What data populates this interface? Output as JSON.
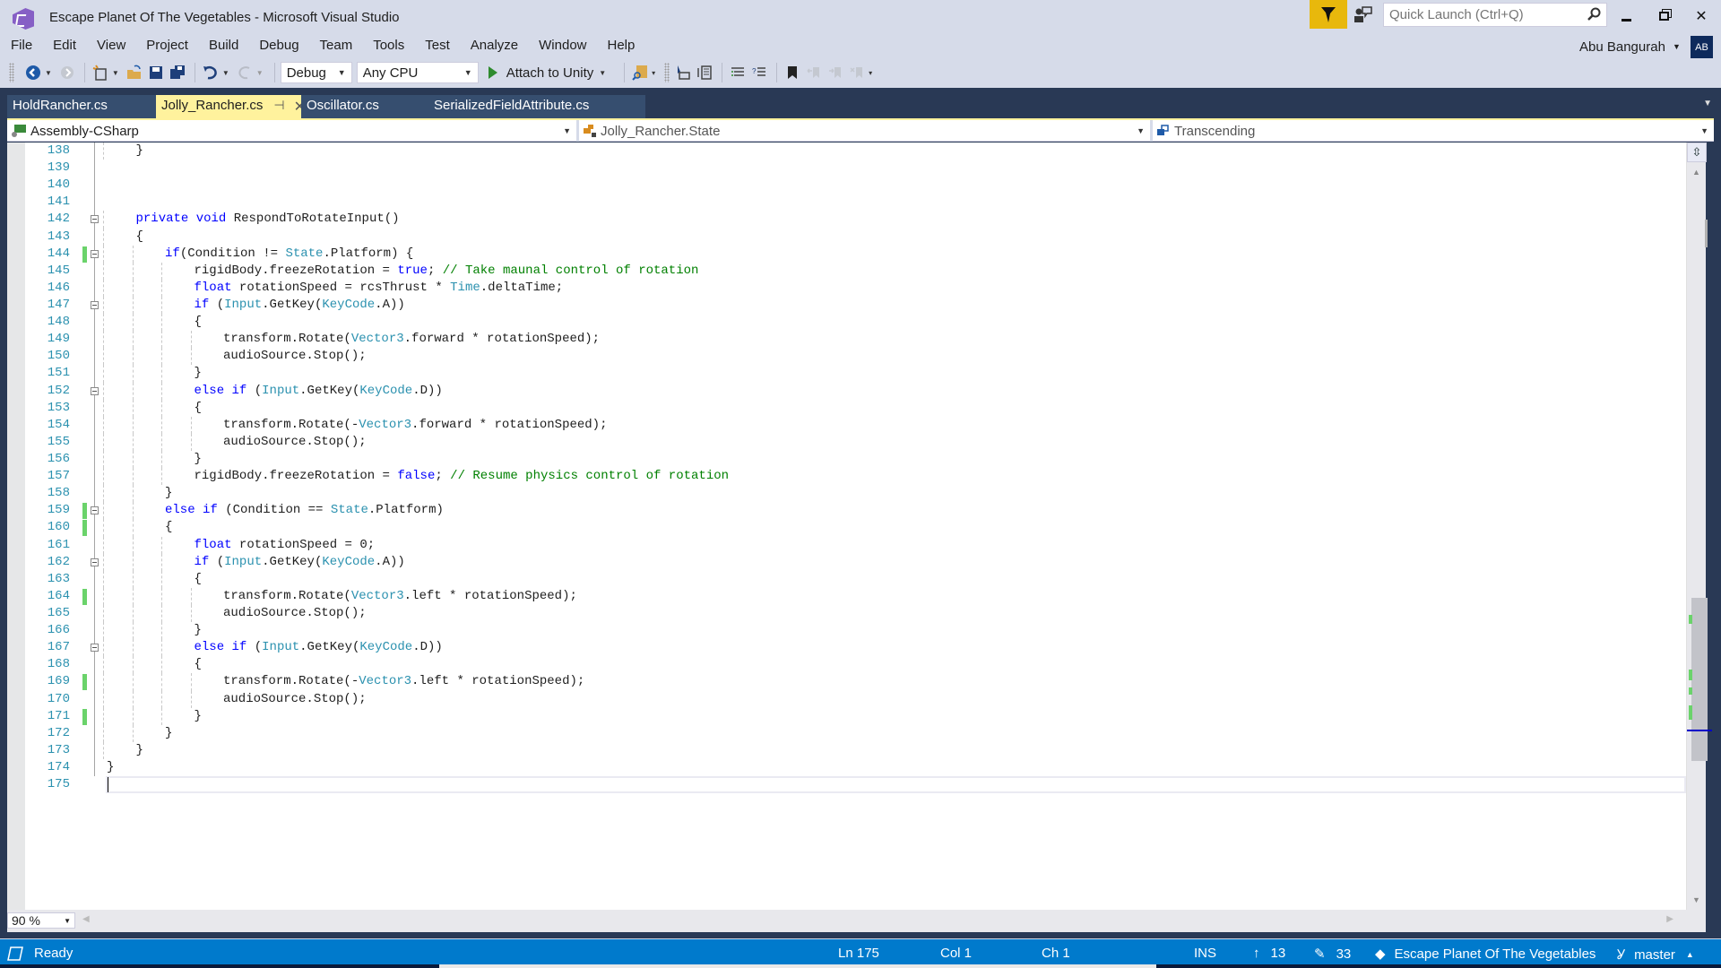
{
  "window": {
    "title": "Escape Planet Of The Vegetables - Microsoft Visual Studio",
    "quick_launch_placeholder": "Quick Launch (Ctrl+Q)",
    "user_name": "Abu Bangurah",
    "user_initials": "AB",
    "accent_color": "#e8b80c"
  },
  "menu": [
    "File",
    "Edit",
    "View",
    "Project",
    "Build",
    "Debug",
    "Team",
    "Tools",
    "Test",
    "Analyze",
    "Window",
    "Help"
  ],
  "toolbar": {
    "configuration": "Debug",
    "platform": "Any CPU",
    "attach_label": "Attach to Unity"
  },
  "tabs": [
    {
      "label": "HoldRancher.cs",
      "active": false
    },
    {
      "label": "Jolly_Rancher.cs",
      "active": true
    },
    {
      "label": "Oscillator.cs",
      "active": false
    },
    {
      "label": "SerializedFieldAttribute.cs",
      "active": false
    }
  ],
  "navbar": {
    "project": "Assembly-CSharp",
    "type": "Jolly_Rancher.State",
    "member": "Transcending"
  },
  "editor": {
    "zoom": "90 %",
    "current_line": 175,
    "lines": [
      {
        "n": 138,
        "indent": 1,
        "code": [
          [
            "p",
            "}"
          ]
        ]
      },
      {
        "n": 139,
        "indent": 0,
        "code": []
      },
      {
        "n": 140,
        "indent": 0,
        "code": []
      },
      {
        "n": 141,
        "indent": 0,
        "code": []
      },
      {
        "n": 142,
        "indent": 1,
        "fold": true,
        "code": [
          [
            "k",
            "private"
          ],
          [
            "p",
            " "
          ],
          [
            "k",
            "void"
          ],
          [
            "p",
            " RespondToRotateInput()"
          ]
        ]
      },
      {
        "n": 143,
        "indent": 1,
        "code": [
          [
            "p",
            "{"
          ]
        ]
      },
      {
        "n": 144,
        "indent": 2,
        "fold": true,
        "changed": true,
        "code": [
          [
            "k",
            "if"
          ],
          [
            "p",
            "(Condition != "
          ],
          [
            "t",
            "State"
          ],
          [
            "p",
            ".Platform) {"
          ]
        ]
      },
      {
        "n": 145,
        "indent": 3,
        "code": [
          [
            "p",
            "rigidBody.freezeRotation = "
          ],
          [
            "k",
            "true"
          ],
          [
            "p",
            "; "
          ],
          [
            "c",
            "// Take maunal control of rotation"
          ]
        ]
      },
      {
        "n": 146,
        "indent": 3,
        "code": [
          [
            "k",
            "float"
          ],
          [
            "p",
            " rotationSpeed = rcsThrust * "
          ],
          [
            "t",
            "Time"
          ],
          [
            "p",
            ".deltaTime;"
          ]
        ]
      },
      {
        "n": 147,
        "indent": 3,
        "fold": true,
        "code": [
          [
            "k",
            "if"
          ],
          [
            "p",
            " ("
          ],
          [
            "t",
            "Input"
          ],
          [
            "p",
            ".GetKey("
          ],
          [
            "t",
            "KeyCode"
          ],
          [
            "p",
            ".A))"
          ]
        ]
      },
      {
        "n": 148,
        "indent": 3,
        "code": [
          [
            "p",
            "{"
          ]
        ]
      },
      {
        "n": 149,
        "indent": 4,
        "code": [
          [
            "p",
            "transform.Rotate("
          ],
          [
            "t",
            "Vector3"
          ],
          [
            "p",
            ".forward * rotationSpeed);"
          ]
        ]
      },
      {
        "n": 150,
        "indent": 4,
        "code": [
          [
            "p",
            "audioSource.Stop();"
          ]
        ]
      },
      {
        "n": 151,
        "indent": 3,
        "code": [
          [
            "p",
            "}"
          ]
        ]
      },
      {
        "n": 152,
        "indent": 3,
        "fold": true,
        "code": [
          [
            "k",
            "else"
          ],
          [
            "p",
            " "
          ],
          [
            "k",
            "if"
          ],
          [
            "p",
            " ("
          ],
          [
            "t",
            "Input"
          ],
          [
            "p",
            ".GetKey("
          ],
          [
            "t",
            "KeyCode"
          ],
          [
            "p",
            ".D))"
          ]
        ]
      },
      {
        "n": 153,
        "indent": 3,
        "code": [
          [
            "p",
            "{"
          ]
        ]
      },
      {
        "n": 154,
        "indent": 4,
        "code": [
          [
            "p",
            "transform.Rotate(-"
          ],
          [
            "t",
            "Vector3"
          ],
          [
            "p",
            ".forward * rotationSpeed);"
          ]
        ]
      },
      {
        "n": 155,
        "indent": 4,
        "code": [
          [
            "p",
            "audioSource.Stop();"
          ]
        ]
      },
      {
        "n": 156,
        "indent": 3,
        "code": [
          [
            "p",
            "}"
          ]
        ]
      },
      {
        "n": 157,
        "indent": 3,
        "code": [
          [
            "p",
            "rigidBody.freezeRotation = "
          ],
          [
            "k",
            "false"
          ],
          [
            "p",
            "; "
          ],
          [
            "c",
            "// Resume physics control of rotation"
          ]
        ]
      },
      {
        "n": 158,
        "indent": 2,
        "code": [
          [
            "p",
            "}"
          ]
        ]
      },
      {
        "n": 159,
        "indent": 2,
        "fold": true,
        "changed": true,
        "code": [
          [
            "k",
            "else"
          ],
          [
            "p",
            " "
          ],
          [
            "k",
            "if"
          ],
          [
            "p",
            " (Condition == "
          ],
          [
            "t",
            "State"
          ],
          [
            "p",
            ".Platform)"
          ]
        ]
      },
      {
        "n": 160,
        "indent": 2,
        "changed": true,
        "code": [
          [
            "p",
            "{"
          ]
        ]
      },
      {
        "n": 161,
        "indent": 3,
        "code": [
          [
            "k",
            "float"
          ],
          [
            "p",
            " rotationSpeed = 0;"
          ]
        ]
      },
      {
        "n": 162,
        "indent": 3,
        "fold": true,
        "code": [
          [
            "k",
            "if"
          ],
          [
            "p",
            " ("
          ],
          [
            "t",
            "Input"
          ],
          [
            "p",
            ".GetKey("
          ],
          [
            "t",
            "KeyCode"
          ],
          [
            "p",
            ".A))"
          ]
        ]
      },
      {
        "n": 163,
        "indent": 3,
        "code": [
          [
            "p",
            "{"
          ]
        ]
      },
      {
        "n": 164,
        "indent": 4,
        "changed": true,
        "code": [
          [
            "p",
            "transform.Rotate("
          ],
          [
            "t",
            "Vector3"
          ],
          [
            "p",
            ".left * rotationSpeed);"
          ]
        ]
      },
      {
        "n": 165,
        "indent": 4,
        "code": [
          [
            "p",
            "audioSource.Stop();"
          ]
        ]
      },
      {
        "n": 166,
        "indent": 3,
        "code": [
          [
            "p",
            "}"
          ]
        ]
      },
      {
        "n": 167,
        "indent": 3,
        "fold": true,
        "code": [
          [
            "k",
            "else"
          ],
          [
            "p",
            " "
          ],
          [
            "k",
            "if"
          ],
          [
            "p",
            " ("
          ],
          [
            "t",
            "Input"
          ],
          [
            "p",
            ".GetKey("
          ],
          [
            "t",
            "KeyCode"
          ],
          [
            "p",
            ".D))"
          ]
        ]
      },
      {
        "n": 168,
        "indent": 3,
        "code": [
          [
            "p",
            "{"
          ]
        ]
      },
      {
        "n": 169,
        "indent": 4,
        "changed": true,
        "code": [
          [
            "p",
            "transform.Rotate(-"
          ],
          [
            "t",
            "Vector3"
          ],
          [
            "p",
            ".left * rotationSpeed);"
          ]
        ]
      },
      {
        "n": 170,
        "indent": 4,
        "code": [
          [
            "p",
            "audioSource.Stop();"
          ]
        ]
      },
      {
        "n": 171,
        "indent": 3,
        "changed": true,
        "code": [
          [
            "p",
            "}"
          ]
        ]
      },
      {
        "n": 172,
        "indent": 2,
        "code": [
          [
            "p",
            "}"
          ]
        ]
      },
      {
        "n": 173,
        "indent": 1,
        "code": [
          [
            "p",
            "}"
          ]
        ]
      },
      {
        "n": 174,
        "indent": 0,
        "code": [
          [
            "p",
            "}"
          ]
        ]
      },
      {
        "n": 175,
        "indent": 0,
        "code": []
      }
    ]
  },
  "statusbar": {
    "state": "Ready",
    "line": "Ln 175",
    "col": "Col 1",
    "ch": "Ch 1",
    "mode": "INS",
    "pushes": "13",
    "edits": "33",
    "repo": "Escape Planet Of The Vegetables",
    "branch": "master",
    "color": "#007acc"
  }
}
